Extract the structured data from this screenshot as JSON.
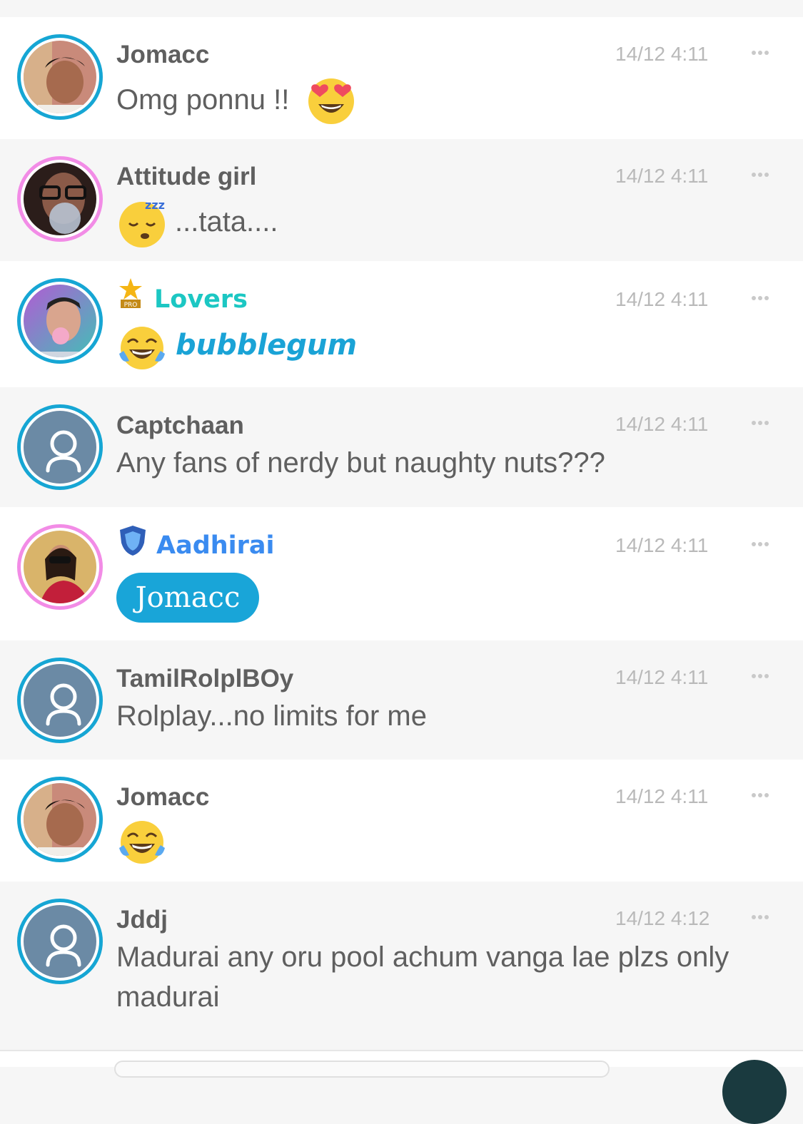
{
  "messages": [
    {
      "name": "Jomacc",
      "time": "14/12 4:11",
      "text": "Omg ponnu !!",
      "emoji": "heart-eyes-emoji"
    },
    {
      "name": "Attitude girl",
      "time": "14/12 4:11",
      "text": "...tata....",
      "emoji": "sleeping-emoji"
    },
    {
      "name": "Lovers",
      "time": "14/12 4:11",
      "text": "bubblegum",
      "emoji": "laughing-tears-emoji",
      "badge": "PRO"
    },
    {
      "name": "Captchaan",
      "time": "14/12 4:11",
      "text": "Any fans of nerdy but naughty nuts???"
    },
    {
      "name": "Aadhirai",
      "time": "14/12 4:11",
      "mention": "Jomacc",
      "badge_icon": "shield-icon"
    },
    {
      "name": "TamilRolplBOy",
      "time": "14/12 4:11",
      "text": "Rolplay...no limits for me"
    },
    {
      "name": "Jomacc",
      "time": "14/12 4:11",
      "emoji": "laughing-tears-emoji"
    },
    {
      "name": "Jddj",
      "time": "14/12 4:12",
      "text": "Madurai any oru pool achum vanga lae plzs only madurai"
    }
  ],
  "colors": {
    "avatar_ring_blue": "#16a6d4",
    "avatar_ring_pink": "#f28ce6",
    "lovers_name": "#1cc7c3",
    "aadhirai_name": "#3a8bf0",
    "accent_text": "#1aa3d6",
    "mention_pill": "#19a5d8",
    "placeholder_avatar": "#6b8aa5"
  }
}
